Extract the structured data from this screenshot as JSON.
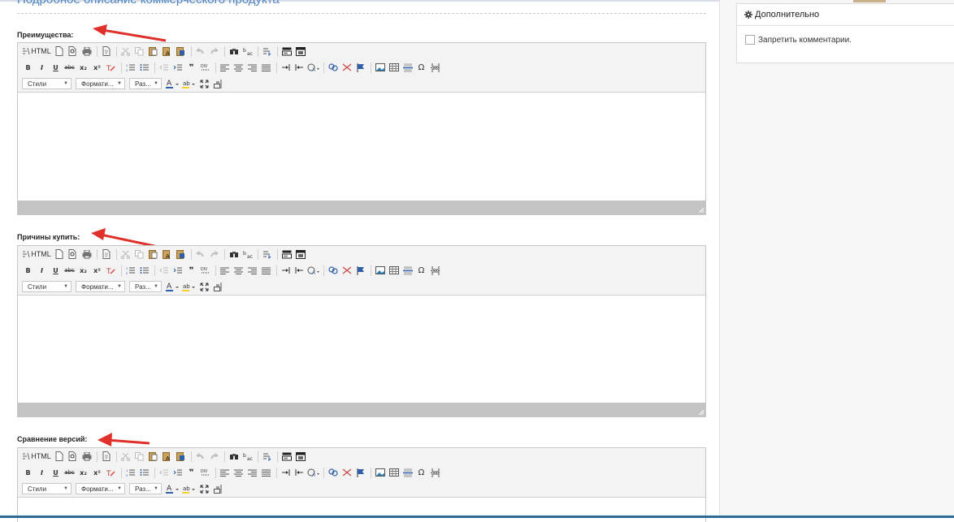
{
  "page": {
    "section_heading": "Подробное описание коммерческого продукта"
  },
  "sidebar": {
    "panel_title": "Дополнительно",
    "disable_comments_label": "Запретить комментарии."
  },
  "colors": {
    "arrow": "#e0302a",
    "heading": "#4f86c3",
    "statusbar": "#c4c4c4"
  },
  "toolbar": {
    "html_button": "HTML",
    "bold": "B",
    "italic": "I",
    "underline": "U",
    "strike": "abc",
    "subscript": "x₂",
    "superscript": "x²",
    "quote": "❞",
    "omega": "Ω",
    "styles_combo": "Стили",
    "format_combo": "Формати...",
    "size_combo": "Раз..."
  },
  "fields": [
    {
      "label": "Преимущества:"
    },
    {
      "label": "Причины купить:"
    },
    {
      "label": "Сравнение версий:"
    }
  ]
}
